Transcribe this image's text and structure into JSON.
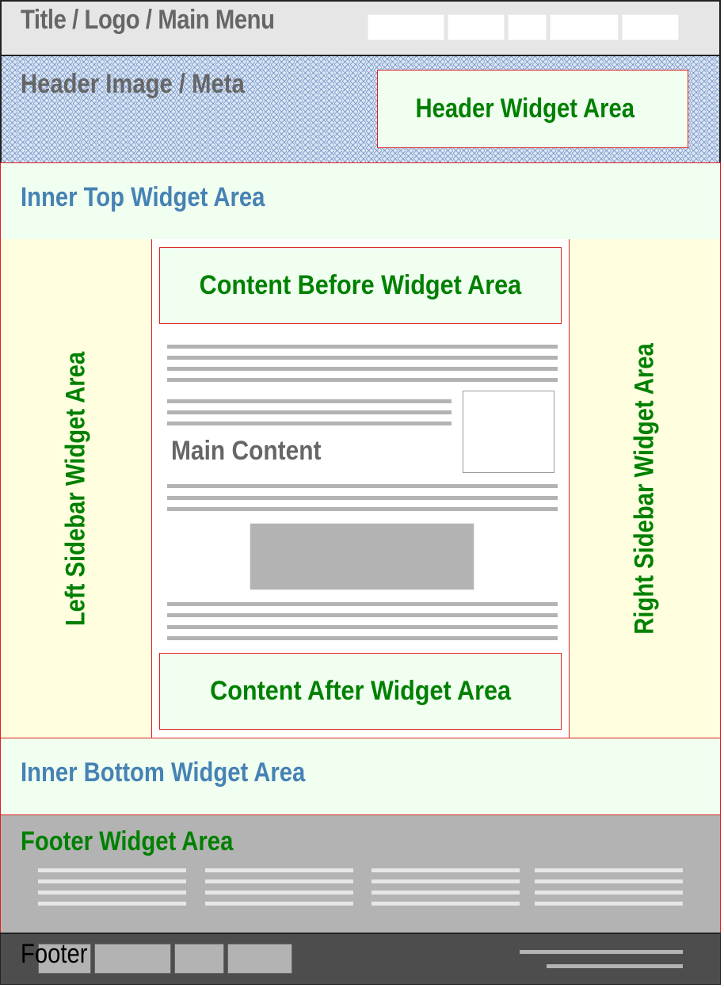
{
  "topbar": {
    "title": "Title / Logo / Main Menu",
    "menu_items": [
      "",
      "",
      "",
      "",
      ""
    ]
  },
  "header": {
    "meta": "Header Image / Meta",
    "widget_label": "Header Widget Area"
  },
  "inner_top": {
    "label": "Inner Top Widget Area"
  },
  "left_sidebar": {
    "label": "Left Sidebar Widget Area"
  },
  "right_sidebar": {
    "label": "Right Sidebar Widget Area"
  },
  "main": {
    "content_before": "Content Before Widget Area",
    "label": "Main Content",
    "content_after": "Content After Widget Area"
  },
  "inner_bottom": {
    "label": "Inner Bottom Widget Area"
  },
  "footer_widget": {
    "label": "Footer Widget Area",
    "columns": 4
  },
  "footer": {
    "label": "Footer",
    "nav_items": [
      "",
      "",
      "",
      ""
    ]
  },
  "colors": {
    "widget_green_text": "#008000",
    "inner_area_blue_text": "#4682b4",
    "widget_background": "#f0fff0",
    "sidebar_background": "#ffffe0",
    "border_red": "#dd2222",
    "placeholder_gray": "#b3b3b3",
    "topbar_background": "#e6e6e6",
    "footer_background": "#4d4d4d"
  }
}
